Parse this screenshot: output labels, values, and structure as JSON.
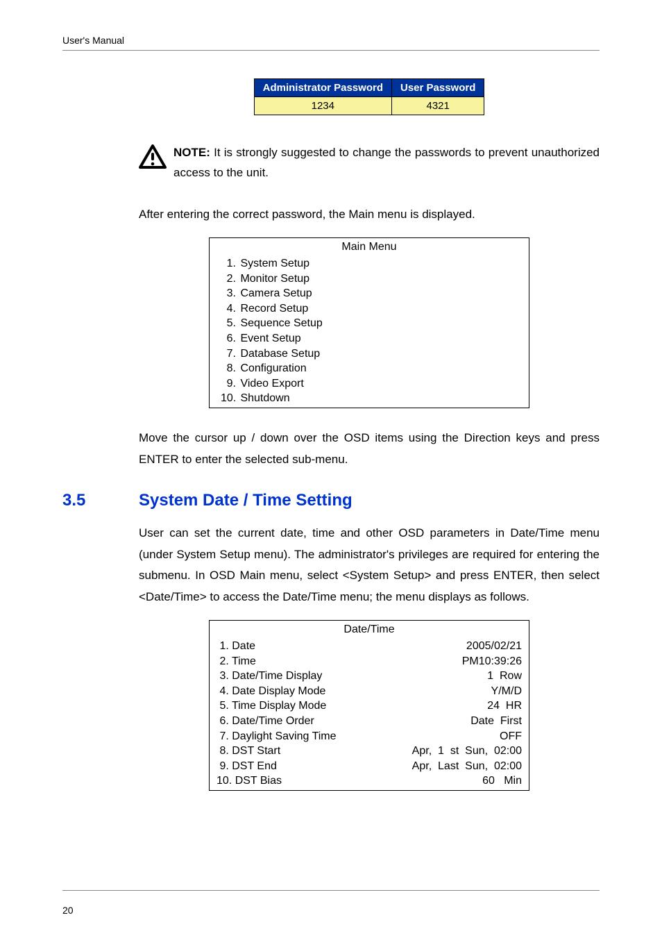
{
  "header": {
    "title": "User's Manual"
  },
  "password_table": {
    "headers": {
      "admin": "Administrator Password",
      "user": "User Password"
    },
    "values": {
      "admin": "1234",
      "user": "4321"
    }
  },
  "note": {
    "label": "NOTE:",
    "text": " It is strongly suggested to change the passwords to prevent unauthorized access to the unit."
  },
  "para_after_note": "After entering the correct password, the Main menu is displayed.",
  "main_menu": {
    "title": "Main Menu",
    "items": [
      "System Setup",
      "Monitor Setup",
      "Camera Setup",
      "Record Setup",
      "Sequence Setup",
      "Event Setup",
      "Database Setup",
      "Configuration",
      "Video Export",
      "Shutdown"
    ]
  },
  "para_after_menu": "Move the cursor up / down over the OSD items using the Direction keys and press ENTER to enter the selected sub-menu.",
  "section": {
    "number": "3.5",
    "title": "System Date / Time Setting",
    "body": "User can set the current date, time and other OSD parameters in Date/Time menu (under System Setup menu). The administrator's privileges are required for entering the submenu. In OSD Main menu, select <System Setup> and press ENTER, then select <Date/Time> to access the Date/Time menu; the menu displays as follows."
  },
  "datetime_menu": {
    "title": "Date/Time",
    "rows": [
      {
        "num": " 1.",
        "label": "Date",
        "value": "2005/02/21"
      },
      {
        "num": " 2.",
        "label": "Time",
        "value": "PM10:39:26"
      },
      {
        "num": " 3.",
        "label": "Date/Time Display",
        "value": "1  Row"
      },
      {
        "num": " 4.",
        "label": "Date Display Mode",
        "value": "Y/M/D"
      },
      {
        "num": " 5.",
        "label": "Time Display Mode",
        "value": "24  HR"
      },
      {
        "num": " 6.",
        "label": "Date/Time Order",
        "value": "Date  First"
      },
      {
        "num": " 7.",
        "label": "Daylight Saving Time",
        "value": "OFF"
      },
      {
        "num": " 8.",
        "label": "DST Start",
        "value": "Apr,  1  st  Sun,  02:00"
      },
      {
        "num": " 9.",
        "label": "DST End",
        "value": "Apr,  Last  Sun,  02:00"
      },
      {
        "num": "10.",
        "label": "DST Bias",
        "value": "60   Min"
      }
    ]
  },
  "footer": {
    "page_number": "20"
  }
}
